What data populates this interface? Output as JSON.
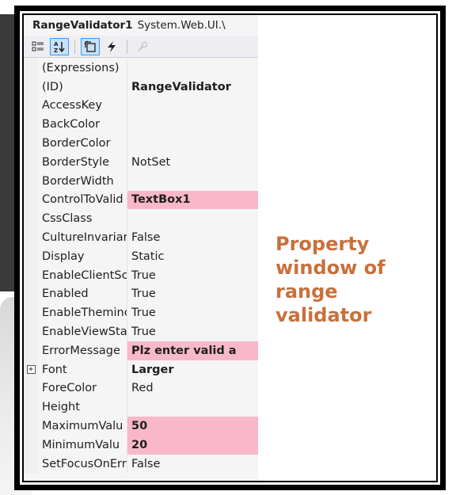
{
  "panel": {
    "title_name": "RangeValidator1",
    "title_type": "System.Web.UI.\\"
  },
  "toolbar": {
    "buttons": [
      "categorized-icon",
      "alphabetical-icon",
      "properties-icon",
      "events-icon",
      "property-pages-icon"
    ]
  },
  "properties": [
    {
      "name": "(Expressions)",
      "value": ""
    },
    {
      "name": "(ID)",
      "value": "RangeValidator"
    },
    {
      "name": "AccessKey",
      "value": ""
    },
    {
      "name": "BackColor",
      "value": ""
    },
    {
      "name": "BorderColor",
      "value": ""
    },
    {
      "name": "BorderStyle",
      "value": "NotSet"
    },
    {
      "name": "BorderWidth",
      "value": ""
    },
    {
      "name": "ControlToValid",
      "value": "TextBox1"
    },
    {
      "name": "CssClass",
      "value": ""
    },
    {
      "name": "CultureInvariar",
      "value": "False"
    },
    {
      "name": "Display",
      "value": "Static"
    },
    {
      "name": "EnableClientSc",
      "value": "True"
    },
    {
      "name": "Enabled",
      "value": "True"
    },
    {
      "name": "EnableTheminc",
      "value": "True"
    },
    {
      "name": "EnableViewStat",
      "value": "True"
    },
    {
      "name": "ErrorMessage",
      "value": "Plz enter valid a"
    },
    {
      "name": "Font",
      "value": "Larger"
    },
    {
      "name": "ForeColor",
      "value": "Red"
    },
    {
      "name": "Height",
      "value": ""
    },
    {
      "name": "MaximumValu",
      "value": "50"
    },
    {
      "name": "MinimumValu",
      "value": "20"
    },
    {
      "name": "SetFocusOnErr",
      "value": "False"
    }
  ],
  "caption": {
    "line1": "Property",
    "line2": "window of",
    "line3": "range",
    "line4": "validator"
  },
  "colors": {
    "highlight": "#f8b8c9",
    "caption": "#c8703c"
  }
}
